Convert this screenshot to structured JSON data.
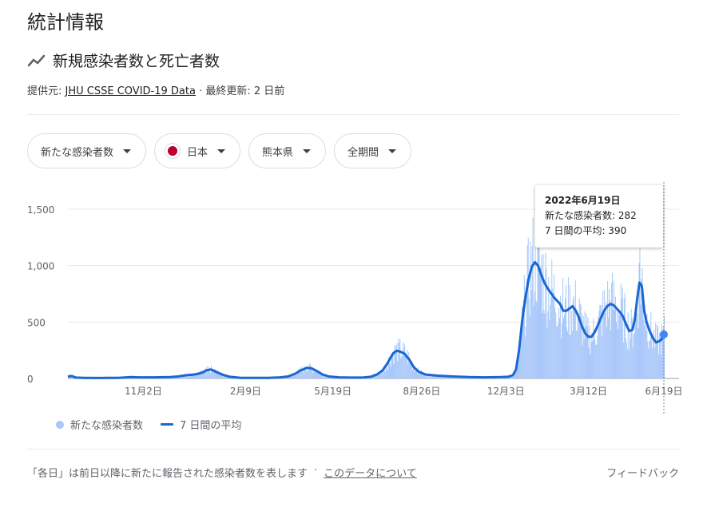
{
  "page_title": "統計情報",
  "section": {
    "title": "新規感染者数と死亡者数",
    "icon": "trending-line-icon"
  },
  "source": {
    "prefix": "提供元:",
    "link": "JHU CSSE COVID-19 Data",
    "updated": "· 最終更新: 2 日前"
  },
  "chips": {
    "metric": "新たな感染者数",
    "country": "日本",
    "region": "熊本県",
    "period": "全期間"
  },
  "tooltip": {
    "date": "2022年6月19日",
    "new_cases": "新たな感染者数: 282",
    "avg": "7 日間の平均: 390"
  },
  "legend": {
    "bars": "新たな感染者数",
    "line": "7 日間の平均"
  },
  "footer": {
    "note": "「各日」は前日以降に新たに報告された感染者数を表します",
    "sep": "·",
    "about": "このデータについて",
    "feedback": "フィードバック"
  },
  "colors": {
    "bar": "#a8c7fa",
    "line": "#1967d2",
    "grid": "#e8eaed"
  },
  "chart_data": {
    "type": "bar",
    "ylim": [
      0,
      1500
    ],
    "yticks": [
      0,
      500,
      1000,
      1500
    ],
    "ytick_labels": [
      "0",
      "500",
      "1,000",
      "1,500"
    ],
    "xtick_labels": [
      "11月2日",
      "2月9日",
      "5月19日",
      "8月26日",
      "12月3日",
      "3月12日",
      "6月19日"
    ],
    "series": [
      {
        "name": "新たな感染者数",
        "type": "bar"
      },
      {
        "name": "7 日間の平均",
        "type": "line"
      }
    ],
    "avg_points": [
      [
        0,
        15
      ],
      [
        3,
        22
      ],
      [
        6,
        20
      ],
      [
        10,
        8
      ],
      [
        20,
        6
      ],
      [
        35,
        4
      ],
      [
        50,
        5
      ],
      [
        64,
        6
      ],
      [
        75,
        10
      ],
      [
        80,
        12
      ],
      [
        90,
        10
      ],
      [
        110,
        10
      ],
      [
        130,
        12
      ],
      [
        140,
        18
      ],
      [
        150,
        28
      ],
      [
        160,
        35
      ],
      [
        166,
        42
      ],
      [
        172,
        55
      ],
      [
        176,
        72
      ],
      [
        182,
        80
      ],
      [
        188,
        60
      ],
      [
        196,
        35
      ],
      [
        206,
        15
      ],
      [
        220,
        6
      ],
      [
        240,
        5
      ],
      [
        255,
        6
      ],
      [
        270,
        10
      ],
      [
        280,
        18
      ],
      [
        290,
        45
      ],
      [
        296,
        72
      ],
      [
        300,
        82
      ],
      [
        304,
        95
      ],
      [
        310,
        90
      ],
      [
        318,
        60
      ],
      [
        324,
        35
      ],
      [
        332,
        18
      ],
      [
        345,
        10
      ],
      [
        360,
        8
      ],
      [
        375,
        8
      ],
      [
        385,
        15
      ],
      [
        393,
        35
      ],
      [
        400,
        70
      ],
      [
        406,
        130
      ],
      [
        410,
        180
      ],
      [
        414,
        225
      ],
      [
        418,
        245
      ],
      [
        422,
        240
      ],
      [
        428,
        220
      ],
      [
        434,
        170
      ],
      [
        440,
        100
      ],
      [
        446,
        60
      ],
      [
        455,
        35
      ],
      [
        470,
        25
      ],
      [
        490,
        18
      ],
      [
        510,
        12
      ],
      [
        530,
        10
      ],
      [
        550,
        12
      ],
      [
        560,
        15
      ],
      [
        566,
        30
      ],
      [
        570,
        80
      ],
      [
        574,
        260
      ],
      [
        578,
        520
      ],
      [
        582,
        720
      ],
      [
        586,
        880
      ],
      [
        590,
        990
      ],
      [
        594,
        1030
      ],
      [
        598,
        1000
      ],
      [
        602,
        920
      ],
      [
        606,
        850
      ],
      [
        610,
        800
      ],
      [
        614,
        760
      ],
      [
        618,
        720
      ],
      [
        622,
        690
      ],
      [
        626,
        660
      ],
      [
        630,
        600
      ],
      [
        634,
        600
      ],
      [
        638,
        620
      ],
      [
        642,
        640
      ],
      [
        646,
        600
      ],
      [
        650,
        540
      ],
      [
        654,
        460
      ],
      [
        658,
        400
      ],
      [
        662,
        370
      ],
      [
        666,
        370
      ],
      [
        670,
        410
      ],
      [
        674,
        470
      ],
      [
        678,
        540
      ],
      [
        682,
        600
      ],
      [
        686,
        640
      ],
      [
        690,
        660
      ],
      [
        694,
        650
      ],
      [
        698,
        620
      ],
      [
        702,
        590
      ],
      [
        706,
        550
      ],
      [
        710,
        480
      ],
      [
        714,
        420
      ],
      [
        718,
        430
      ],
      [
        721,
        520
      ],
      [
        724,
        700
      ],
      [
        727,
        850
      ],
      [
        730,
        820
      ],
      [
        733,
        600
      ],
      [
        736,
        500
      ],
      [
        740,
        420
      ],
      [
        744,
        360
      ],
      [
        748,
        320
      ],
      [
        752,
        330
      ],
      [
        755,
        345
      ],
      [
        758,
        390
      ]
    ]
  }
}
